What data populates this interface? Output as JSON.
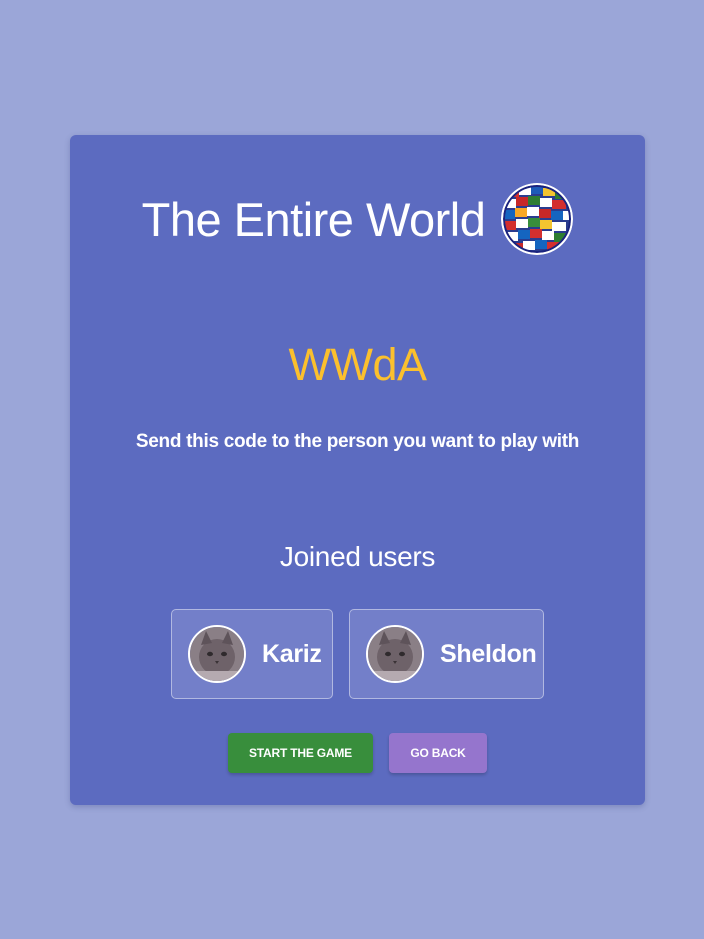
{
  "colors": {
    "page_background": "#9ba6d8",
    "card_background": "#5c6bc0",
    "code_color": "#fbc02d",
    "start_button": "#388e3c",
    "back_button": "#9575cd"
  },
  "header": {
    "title": "The Entire World",
    "logo_icon": "world-flags-globe-icon"
  },
  "room": {
    "code": "WWdA",
    "hint": "Send this code to the person you want to play with"
  },
  "joined": {
    "title": "Joined users",
    "users": [
      {
        "name": "Kariz",
        "avatar_icon": "cat-avatar-icon"
      },
      {
        "name": "Sheldon",
        "avatar_icon": "cat-avatar-icon"
      }
    ]
  },
  "actions": {
    "start_label": "START THE GAME",
    "back_label": "GO BACK"
  }
}
